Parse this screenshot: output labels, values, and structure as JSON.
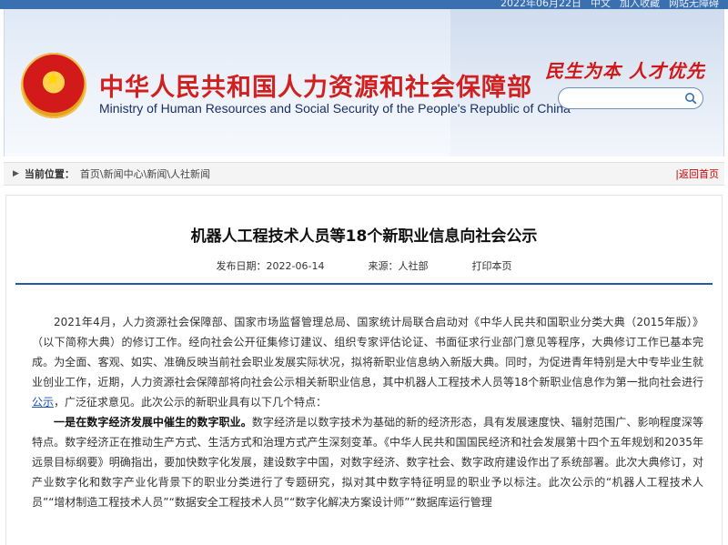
{
  "topbar": {
    "date": "2022年06月22日",
    "lang": "中文",
    "favorite": "加入收藏",
    "barrier_free": "网站无障碍"
  },
  "header": {
    "title": "中华人民共和国人力资源和社会保障部",
    "subtitle": "Ministry of Human Resources and Social Security of the People's Republic of China",
    "slogan": "民生为本 人才优先",
    "search": {
      "value": "",
      "placeholder": ""
    }
  },
  "breadcrumb": {
    "label": "当前位置：",
    "path": "首页\\新闻中心\\新闻\\人社新闻",
    "back": "|返回首页"
  },
  "article": {
    "title": "机器人工程技术人员等18个新职业信息向社会公示",
    "publish_date": "发布日期：2022-06-14",
    "source": "来源：人社部",
    "print": "打印本页",
    "p1_text": "2021年4月，人力资源社会保障部、国家市场监督管理总局、国家统计局联合启动对《中华人民共和国职业分类大典（2015年版）》（以下简称大典）的修订工作。经向社会公开征集修订建议、组织专家评估论证、书面征求行业部门意见等程序，大典修订工作已基本完成。为全面、客观、如实、准确反映当前社会职业发展实际状况，拟将新职业信息纳入新版大典。同时，为促进青年特别是大中专毕业生就业创业工作，近期，人力资源社会保障部将向社会公示相关新职业信息，其中机器人工程技术人员等18个新职业信息作为第一批向社会进行",
    "p1_link": "公示",
    "p1_tail": "，广泛征求意见。此次公示的新职业具有以下几个特点：",
    "p2_bold": "一是在数字经济发展中催生的数字职业。",
    "p2_text": "数字经济是以数字技术为基础的新的经济形态，具有发展速度快、辐射范围广、影响程度深等特点。数字经济正在推动生产方式、生活方式和治理方式产生深刻变革。《中华人民共和国国民经济和社会发展第十四个五年规划和2035年远景目标纲要》明确指出，要加快数字化发展，建设数字中国，对数字经济、数字社会、数字政府建设作出了系统部署。此次大典修订，对产业数字化和数字产业化背景下的职业分类进行了专题研究，拟对其中数字特征明显的职业予以标注。此次公示的“机器人工程技术人员”“增材制造工程技术人员”“数据安全工程技术人员”“数字化解决方案设计师”“数据库运行管理"
  },
  "colors": {
    "title_red": "#d02020",
    "divider_blue": "#1e5aa8",
    "link_blue": "#1a4fb0"
  }
}
